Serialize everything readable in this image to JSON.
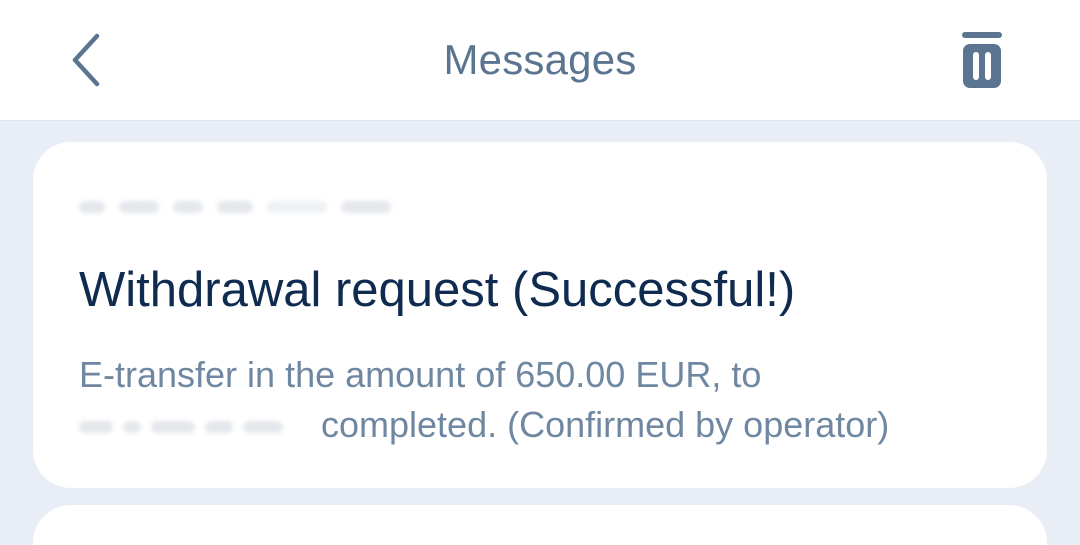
{
  "header": {
    "title": "Messages",
    "back_icon": "chevron-left-icon",
    "delete_icon": "trash-icon"
  },
  "message": {
    "date_redacted": true,
    "title": "Withdrawal request (Successful!)",
    "body_line1": "E-transfer in the amount of 650.00 EUR, to",
    "recipient_redacted": true,
    "body_line2_tail": "completed. (Confirmed by operator)"
  },
  "colors": {
    "background": "#e9edf5",
    "header_bg": "#ffffff",
    "title_text": "#0f2b4f",
    "secondary_text": "#6f87a0",
    "icon": "#5b7591"
  }
}
